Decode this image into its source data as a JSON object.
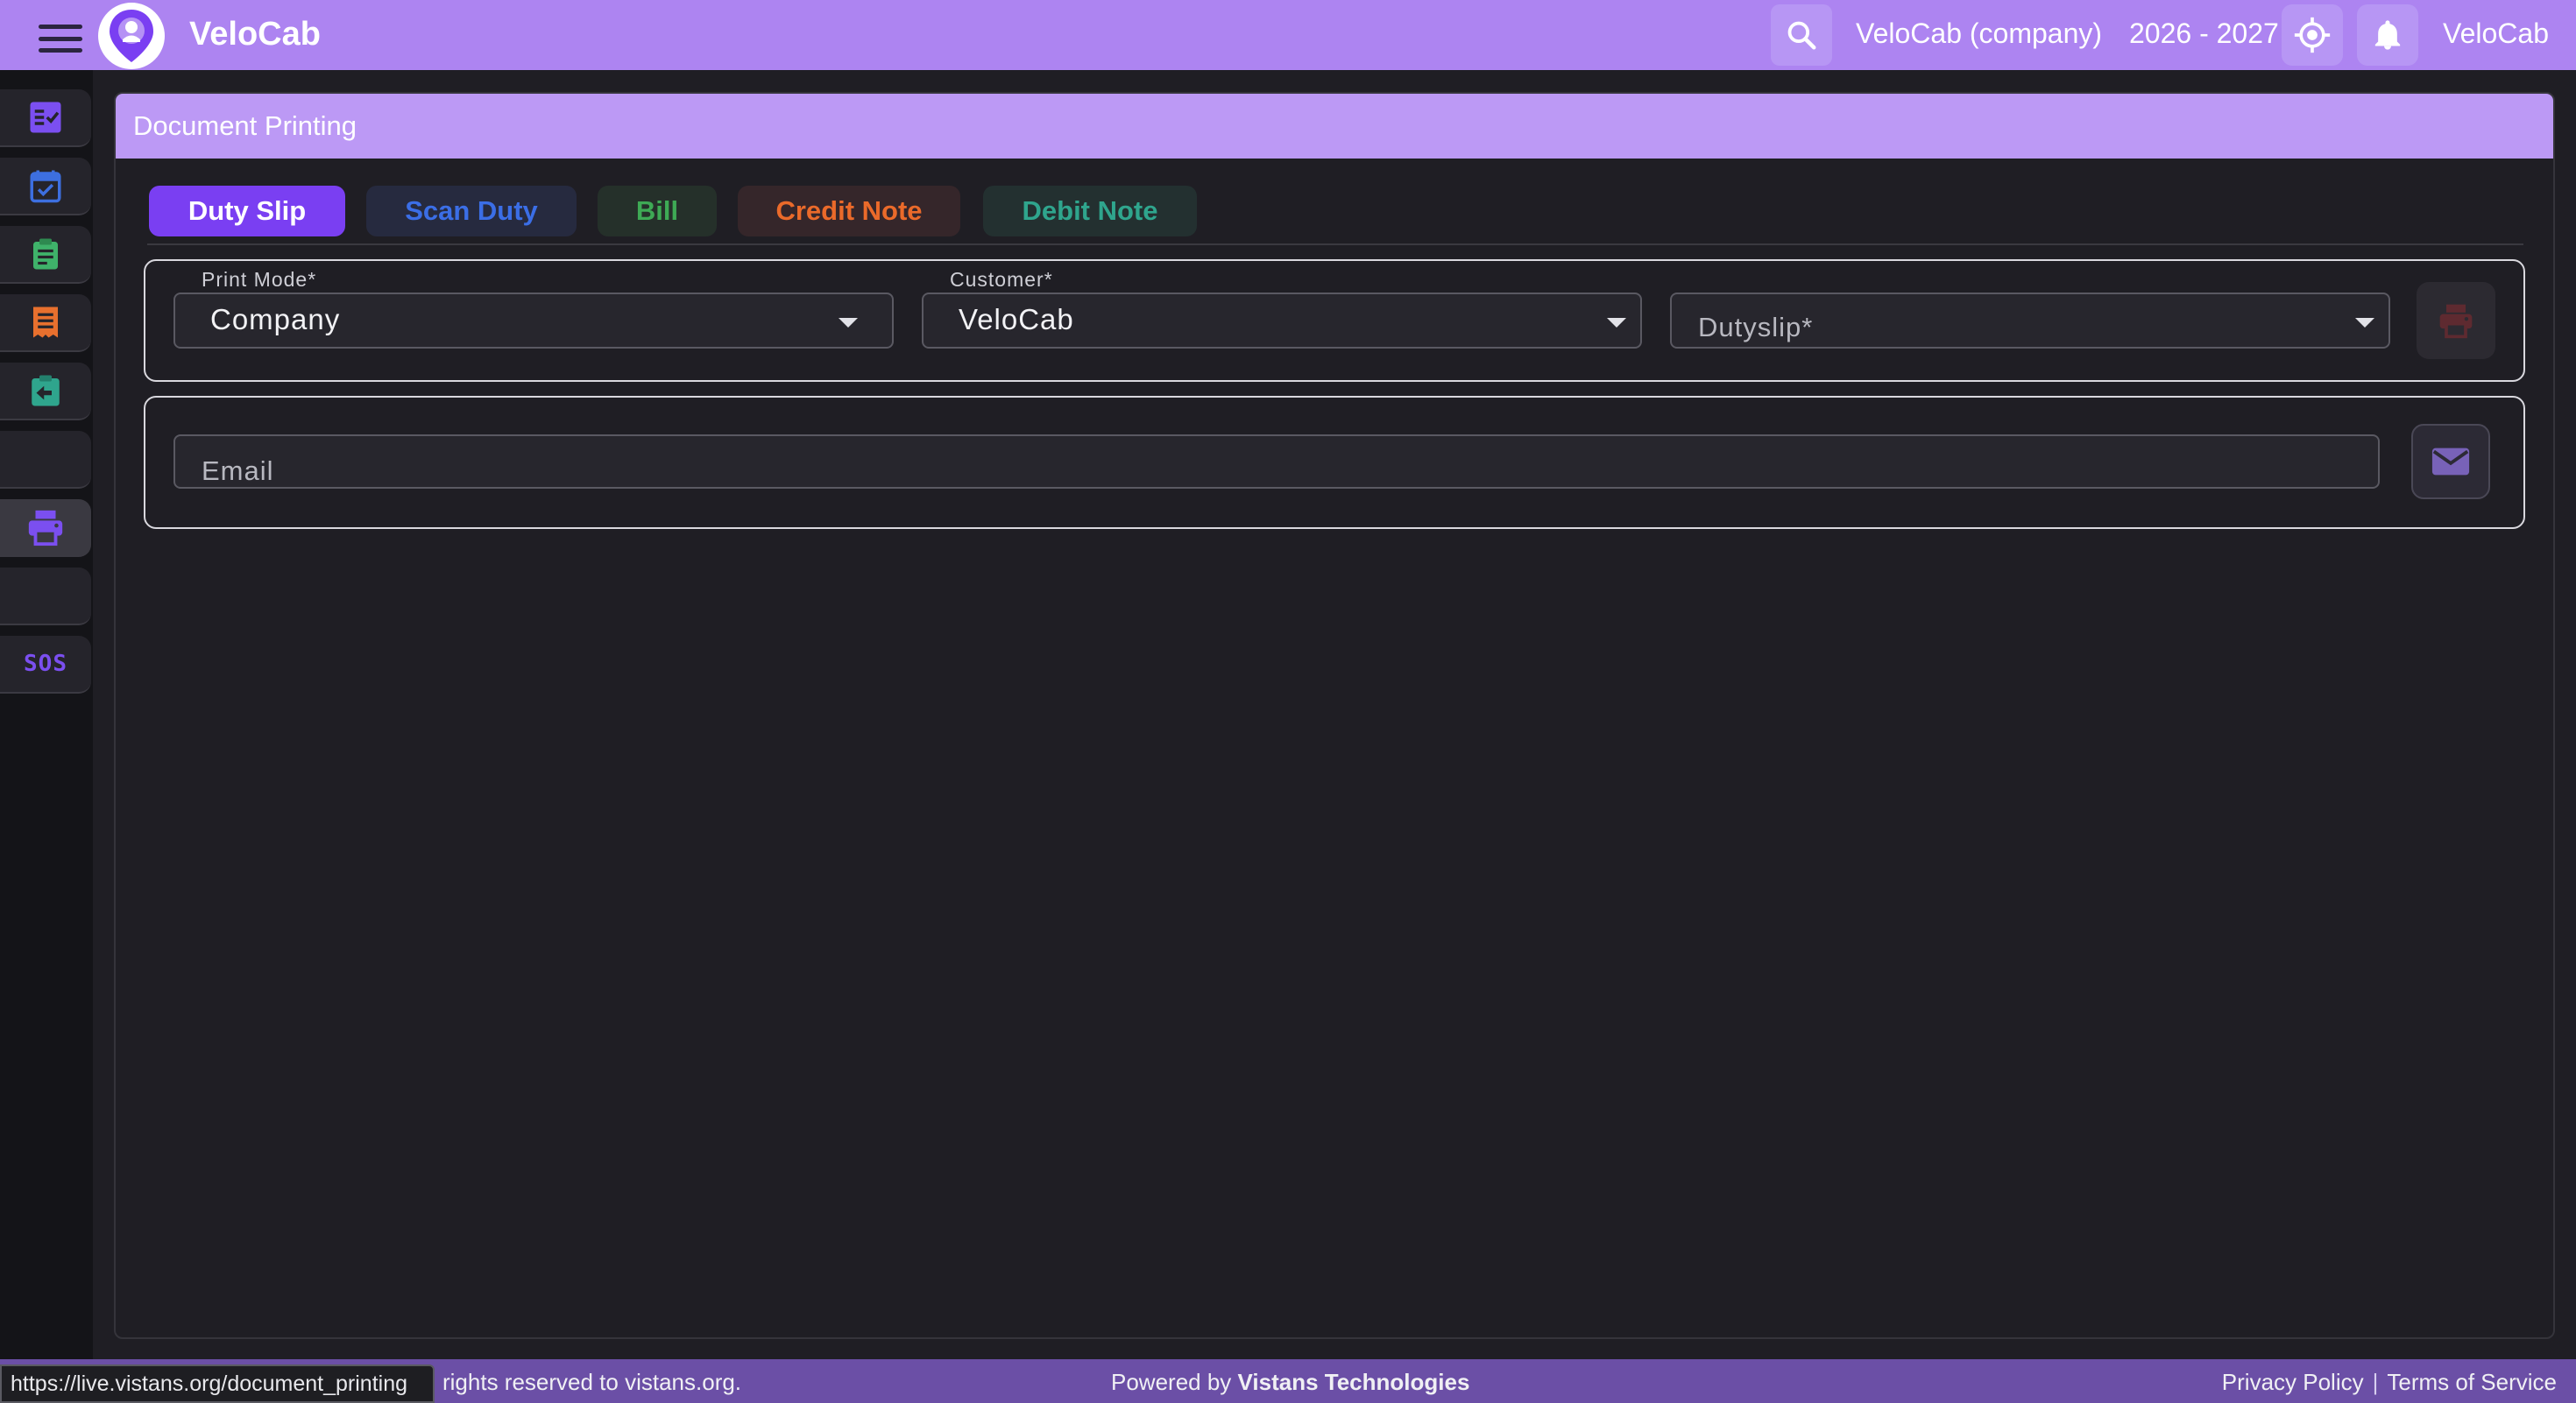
{
  "app": {
    "title": "VeloCab",
    "company": "VeloCab (company)",
    "year": "2026 - 2027",
    "user": "VeloCab"
  },
  "icons": {
    "menu": "hamburger-icon",
    "search": "search-icon",
    "locate": "crosshair-icon",
    "bell": "bell-icon",
    "print": "printer-icon",
    "mail": "mail-icon"
  },
  "sidebar": {
    "items": [
      {
        "icon": "checklist-icon",
        "color": "#7b4ff0"
      },
      {
        "icon": "calendar-check-icon",
        "color": "#3d6fe0"
      },
      {
        "icon": "clipboard-icon",
        "color": "#3fb26a"
      },
      {
        "icon": "receipt-icon",
        "color": "#e8702e"
      },
      {
        "icon": "assignment-return-icon",
        "color": "#2fa58d"
      },
      {
        "icon": "blank",
        "color": ""
      },
      {
        "icon": "printer-icon",
        "color": "#7b4ff0"
      },
      {
        "icon": "blank",
        "color": ""
      },
      {
        "icon": "sos-icon",
        "label": "SOS",
        "color": "#7b4ff0"
      }
    ]
  },
  "page": {
    "title": "Document Printing"
  },
  "tabs": [
    {
      "label": "Duty Slip",
      "color": "#ffffff",
      "bg": "#7a3ff2",
      "active": true
    },
    {
      "label": "Scan Duty",
      "color": "#3b6ee6",
      "bg": "#262a3f",
      "active": false
    },
    {
      "label": "Bill",
      "color": "#3eaa55",
      "bg": "#25302a",
      "active": false
    },
    {
      "label": "Credit Note",
      "color": "#ea6a2a",
      "bg": "#35262a",
      "active": false
    },
    {
      "label": "Debit Note",
      "color": "#2fa58d",
      "bg": "#233030",
      "active": false
    }
  ],
  "form": {
    "print_mode": {
      "label": "Print Mode*",
      "value": "Company"
    },
    "customer": {
      "label": "Customer*",
      "value": "VeloCab"
    },
    "dutyslip": {
      "placeholder": "Dutyslip*"
    },
    "email": {
      "placeholder": "Email"
    }
  },
  "footer": {
    "url": "https://live.vistans.org/document_printing",
    "copyright": "rights reserved to vistans.org.",
    "powered_prefix": "Powered by ",
    "powered_brand": "Vistans Technologies",
    "privacy": "Privacy Policy",
    "separator": "|",
    "terms": "Terms of Service"
  }
}
